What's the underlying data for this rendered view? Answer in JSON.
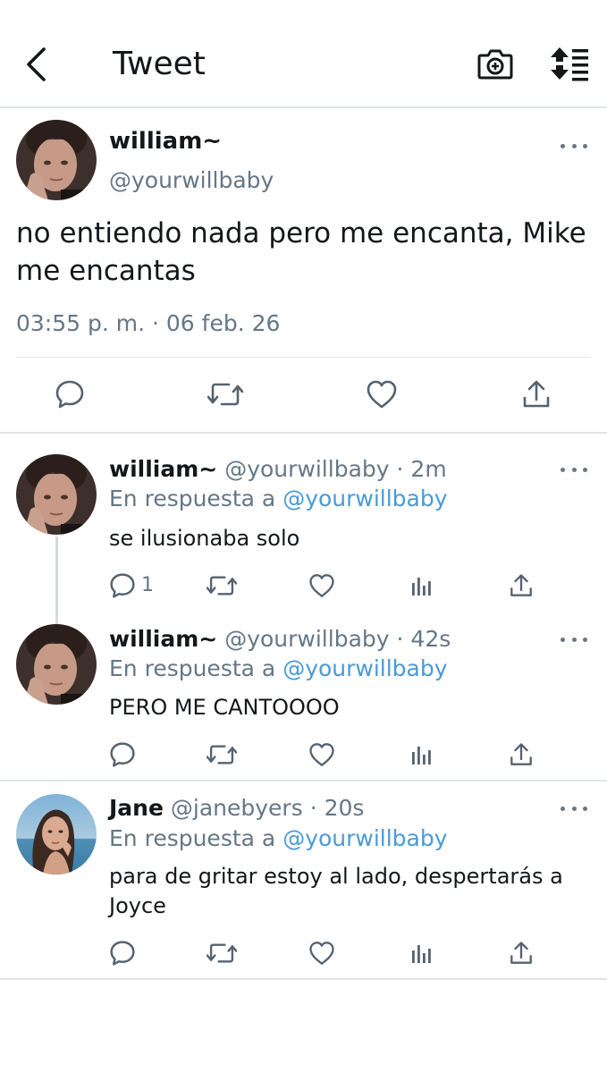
{
  "header": {
    "title": "Tweet",
    "icons": [
      "back-chevron-icon",
      "camera-plus-icon",
      "sort-icon"
    ]
  },
  "main_tweet": {
    "name": "william~",
    "handle": "@yourwillbaby",
    "text": "no entiendo nada pero me encanta, Mike me encantas",
    "timestamp": "03:55 p. m. · 06 feb. 26",
    "actions": [
      "reply-icon",
      "retweet-icon",
      "like-icon",
      "share-icon"
    ]
  },
  "replies": [
    {
      "name": "william~",
      "handle": "@yourwillbaby",
      "time": "· 2m",
      "reply_prefix": "En respuesta a",
      "reply_to": "@yourwillbaby",
      "text": "se ilusionaba solo",
      "reply_count": "1"
    },
    {
      "name": "william~",
      "handle": "@yourwillbaby",
      "time": "· 42s",
      "reply_prefix": "En respuesta a",
      "reply_to": "@yourwillbaby",
      "text": "PERO ME CANTOOOO",
      "reply_count": ""
    },
    {
      "name": "Jane",
      "handle": "@janebyers",
      "time": "· 20s",
      "reply_prefix": "En respuesta a",
      "reply_to": "@yourwillbaby",
      "text": "para de gritar estoy al lado, despertarás a Joyce",
      "reply_count": ""
    }
  ],
  "colors": {
    "text": "#14171a",
    "secondary": "#657786",
    "mention": "#4a9ad6",
    "divider": "#e1e4e6"
  }
}
